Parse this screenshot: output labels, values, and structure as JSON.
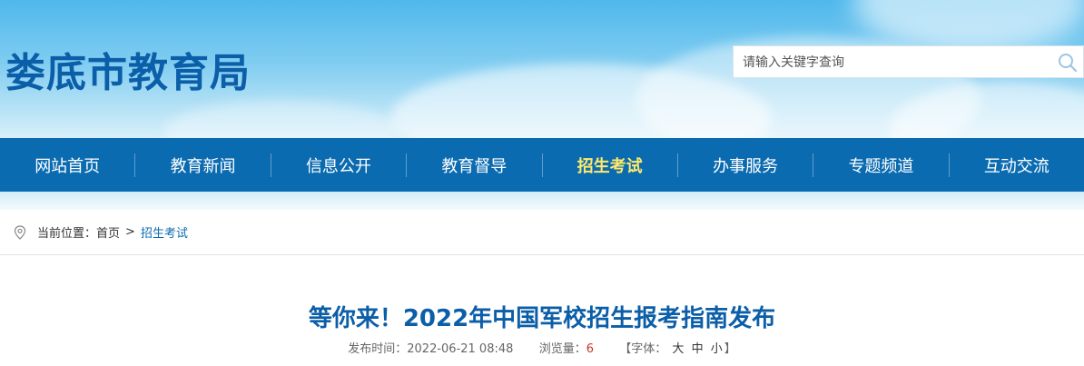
{
  "header": {
    "site_title": "娄底市教育局",
    "search_placeholder": "请输入关键字查询"
  },
  "nav": {
    "items": [
      {
        "label": "网站首页"
      },
      {
        "label": "教育新闻"
      },
      {
        "label": "信息公开"
      },
      {
        "label": "教育督导"
      },
      {
        "label": "招生考试",
        "active": true
      },
      {
        "label": "办事服务"
      },
      {
        "label": "专题频道"
      },
      {
        "label": "互动交流"
      }
    ]
  },
  "breadcrumb": {
    "label": "当前位置：",
    "home": "首页",
    "separator": ">",
    "current": "招生考试"
  },
  "article": {
    "title": "等你来！2022年中国军校招生报考指南发布",
    "publish_label": "发布时间：",
    "publish_time": "2022-06-21 08:48",
    "views_label": "浏览量：",
    "views_value": "6",
    "font_open": "【字体：",
    "font_large": "大",
    "font_medium": "中",
    "font_small": "小",
    "font_close": "】"
  },
  "colors": {
    "nav_bg": "#0b6bb0",
    "nav_active": "#ffe96b",
    "title_blue": "#0b5ea8"
  }
}
